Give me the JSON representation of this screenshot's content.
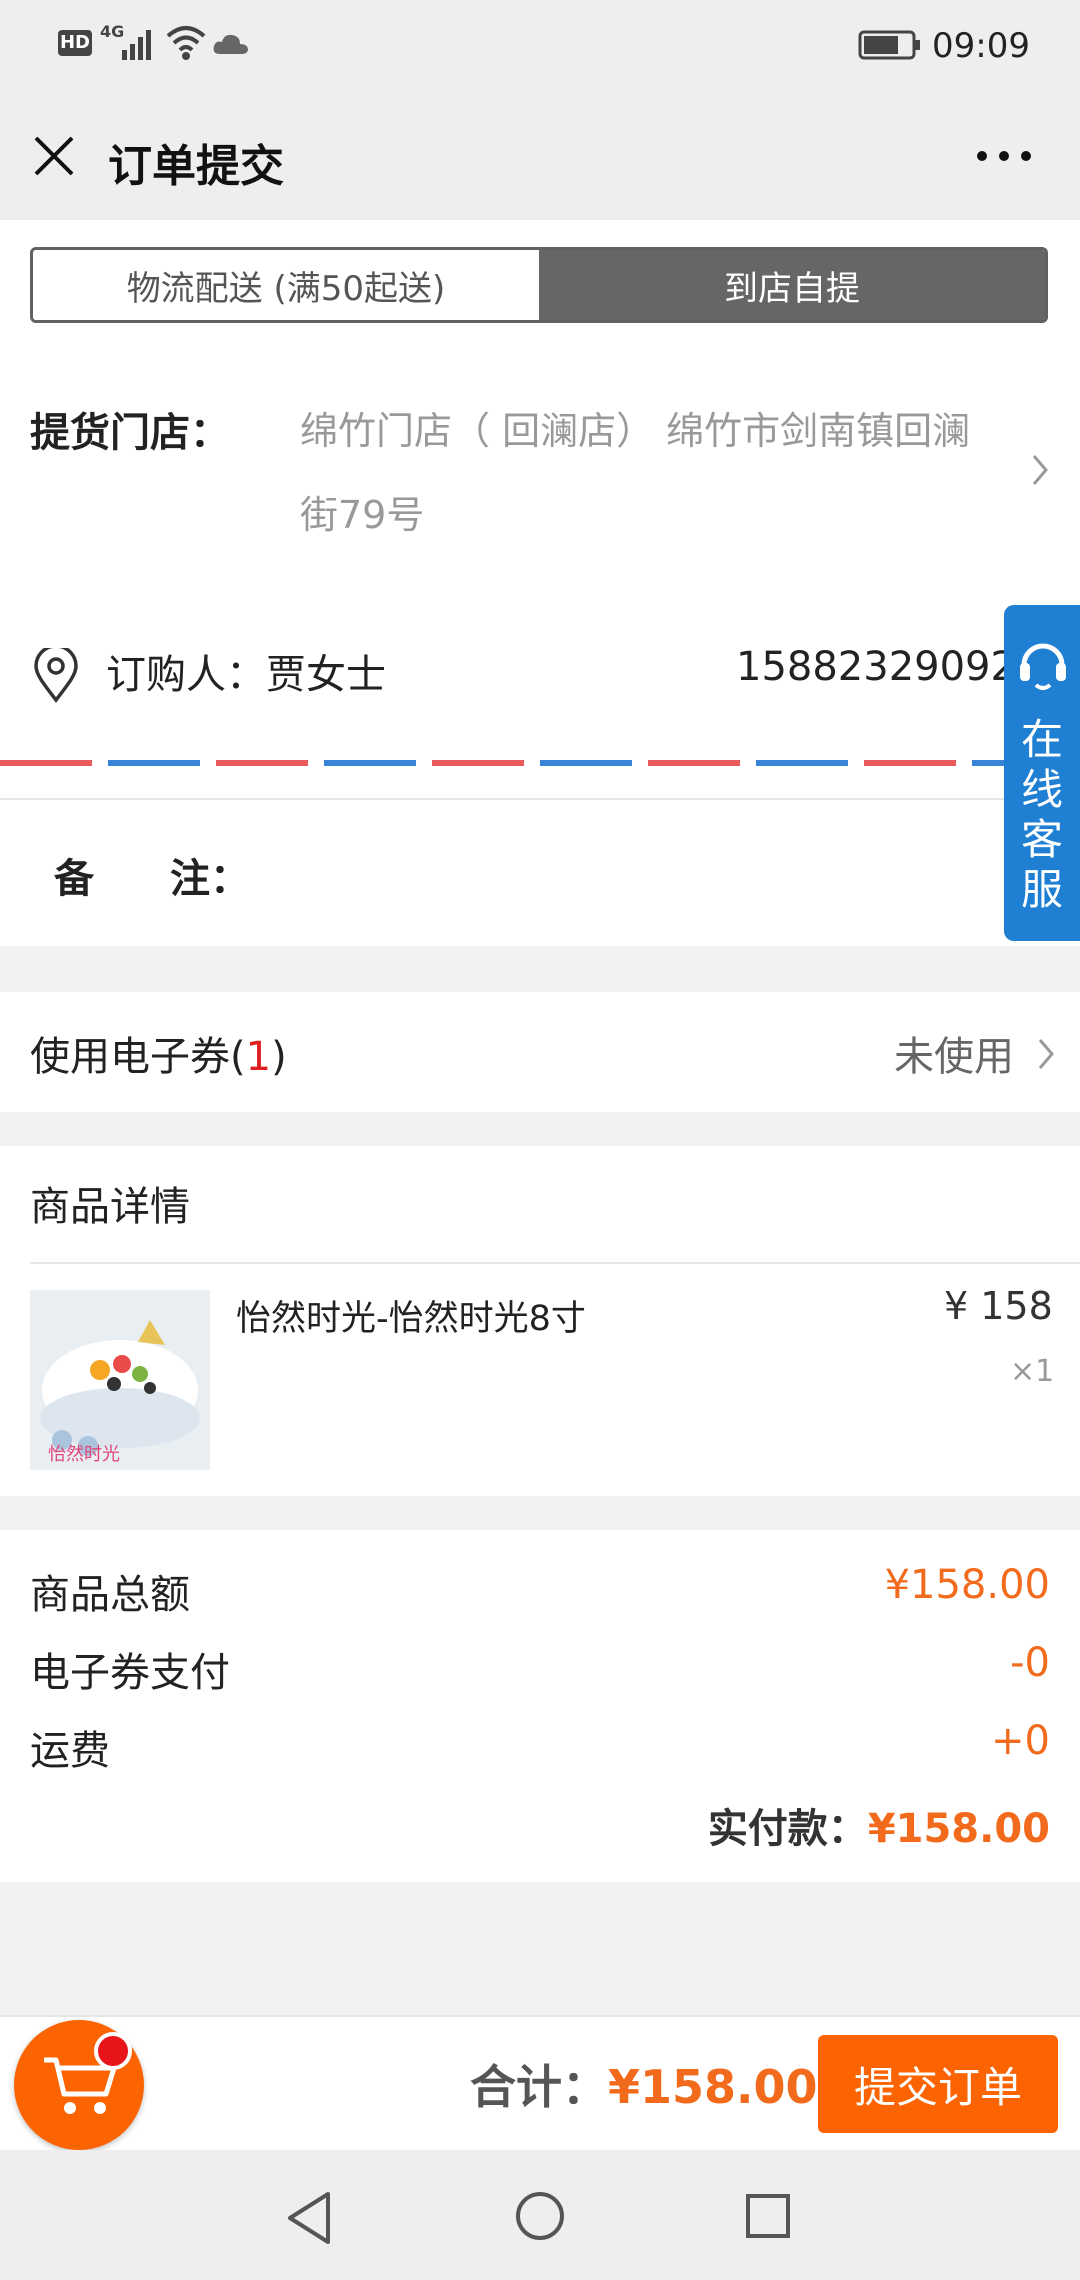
{
  "status_bar": {
    "left_icons": [
      "hd-icon",
      "4g-signal-icon",
      "wifi-icon",
      "cloud-icon"
    ],
    "hd": "HD",
    "net": "4G",
    "time": "09:09"
  },
  "header": {
    "title": "订单提交"
  },
  "delivery": {
    "options": [
      "物流配送 (满50起送)",
      "到店自提"
    ],
    "selected": 1
  },
  "pickup": {
    "label": "提货门店：",
    "store_line1": "绵竹门店（ 回澜店） 绵竹市剑南镇回澜",
    "store_line2": "街79号"
  },
  "buyer": {
    "label": "订购人：贾女士",
    "phone": "15882329092"
  },
  "remark": {
    "label1": "备",
    "label2": "注："
  },
  "coupon": {
    "label_prefix": "使用电子券(",
    "count": "1",
    "label_suffix": ")",
    "status": "未使用"
  },
  "goods": {
    "section_title": "商品详情",
    "items": [
      {
        "name": "怡然时光-怡然时光8寸",
        "price": "¥ 158",
        "qty": "×1",
        "image_caption": "怡然时光"
      }
    ]
  },
  "summary": {
    "rows": [
      {
        "label": "商品总额",
        "value": "¥158.00"
      },
      {
        "label": "电子券支付",
        "value": "-0"
      },
      {
        "label": "运费",
        "value": "+0"
      }
    ],
    "paid_label": "实付款：",
    "paid_value": "¥158.00"
  },
  "footer": {
    "total_label": "合计：",
    "total_value": "¥158.00",
    "submit_label": "提交订单"
  },
  "service": {
    "label": "在线客服"
  },
  "colors": {
    "accent": "#fb6400",
    "price_orange": "#f26a1b",
    "service_blue": "#1e7fd3"
  }
}
